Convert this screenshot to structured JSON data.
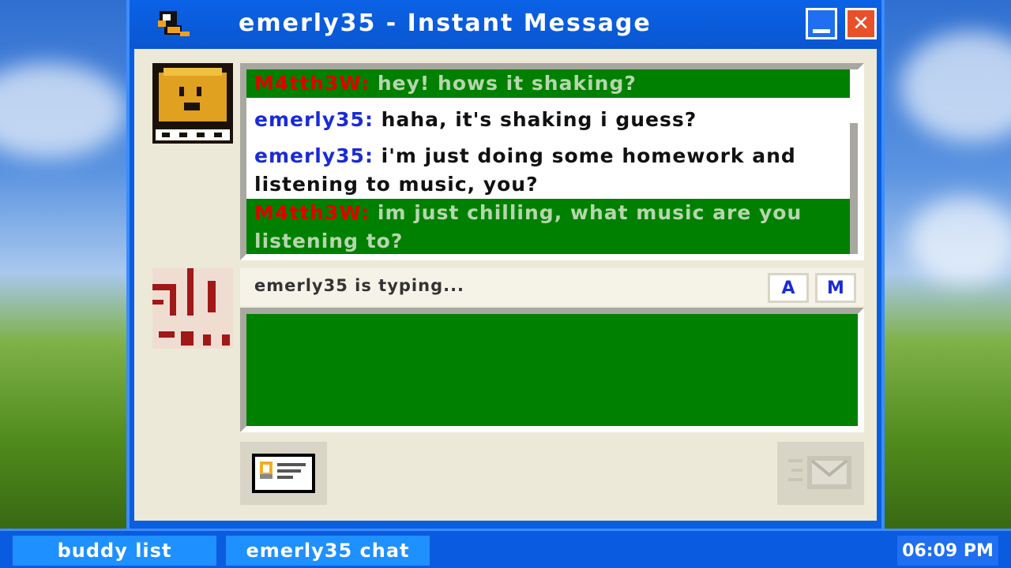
{
  "window": {
    "title": "emerly35 - Instant Message"
  },
  "chat_log": {
    "messages": [
      {
        "sender": "M4tth3W:",
        "text": " hey! hows it shaking?",
        "from": "buddy"
      },
      {
        "sender": "emerly35:",
        "text": " haha, it's shaking i guess?",
        "from": "me"
      },
      {
        "sender": "emerly35:",
        "text": " i'm just doing some homework and listening to music, you?",
        "from": "me"
      },
      {
        "sender": "M4tth3W:",
        "text": " im just chilling, what music are you listening to?",
        "from": "buddy"
      }
    ]
  },
  "status": {
    "typing_text": "emerly35 is typing..."
  },
  "format_buttons": {
    "font_label": "A",
    "emote_label": "M"
  },
  "taskbar": {
    "buddy_list_label": "buddy list",
    "chat_label": "emerly35 chat",
    "clock": "06:09 PM"
  },
  "colors": {
    "titlebar": "#0a5fe0",
    "message_green": "#008000",
    "buddy_name": "#e00000",
    "my_name": "#1a2bd6"
  },
  "icons": {
    "title": "duck-icon",
    "minimize": "minimize-icon",
    "close": "close-icon",
    "profile": "profile-card-icon",
    "send": "send-envelope-icon"
  }
}
